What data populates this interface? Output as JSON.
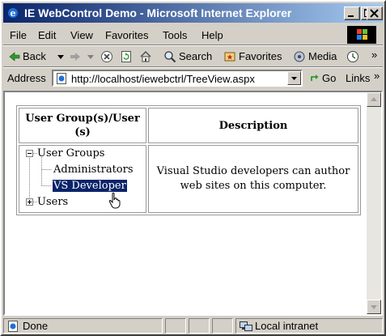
{
  "window": {
    "title": "IE WebControl Demo - Microsoft Internet Explorer"
  },
  "menu": {
    "items": [
      "File",
      "Edit",
      "View",
      "Favorites",
      "Tools",
      "Help"
    ]
  },
  "toolbar": {
    "back_label": "Back",
    "search_label": "Search",
    "favorites_label": "Favorites",
    "media_label": "Media"
  },
  "address": {
    "label": "Address",
    "url": "http://localhost/iewebctrl/TreeView.aspx",
    "go_label": "Go",
    "links_label": "Links"
  },
  "page": {
    "header_group": "User Group(s)/User (s)",
    "header_desc": "Description",
    "tree": {
      "root": "User Groups",
      "child1": "Administrators",
      "child2": "VS Developer",
      "users": "Users"
    },
    "description": "Visual Studio developers can author web sites on this computer."
  },
  "status": {
    "text": "Done",
    "zone": "Local intranet"
  },
  "colors": {
    "titlebar_start": "#0a246a",
    "titlebar_end": "#a6caf0",
    "selection": "#0a246a",
    "chrome": "#d4d0c8"
  },
  "icons": [
    "ie-icon",
    "minimize-icon",
    "maximize-icon",
    "close-icon",
    "windows-logo-icon",
    "back-arrow-icon",
    "forward-arrow-icon",
    "stop-icon",
    "refresh-icon",
    "home-icon",
    "search-icon",
    "favorites-icon",
    "media-icon",
    "history-icon",
    "page-icon",
    "dropdown-arrow-icon",
    "go-arrow-icon",
    "collapse-icon",
    "expand-icon",
    "hand-cursor-icon",
    "scroll-up-icon",
    "scroll-down-icon",
    "intranet-icon"
  ]
}
